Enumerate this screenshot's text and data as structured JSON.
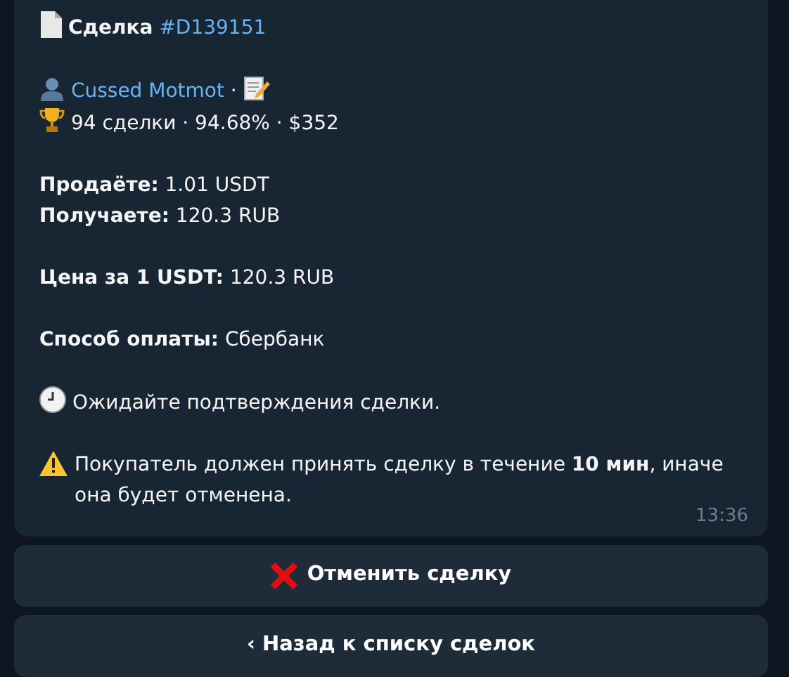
{
  "title": {
    "label": "Сделка",
    "deal_id": "#D139151"
  },
  "user": {
    "name": "Cussed Motmot",
    "separator": "·"
  },
  "stats": "94 сделки · 94.68% · $352",
  "field_groups": [
    [
      "**Продаёте:** 1.01 USDT",
      "**Получаете:** 120.3 RUB"
    ],
    [
      "**Цена за 1 USDT:** 120.3 RUB"
    ],
    [
      "**Способ оплаты:** Сбербанк"
    ]
  ],
  "status": "Ожидайте подтверждения сделки.",
  "warning": "Покупатель должен принять сделку в течение **10 мин**, иначе она будет отменена.",
  "time": "13:36",
  "buttons": [
    {
      "kind": "cancel",
      "label": "Отменить сделку"
    },
    {
      "kind": "back",
      "label": "‹ Назад к списку сделок"
    }
  ]
}
